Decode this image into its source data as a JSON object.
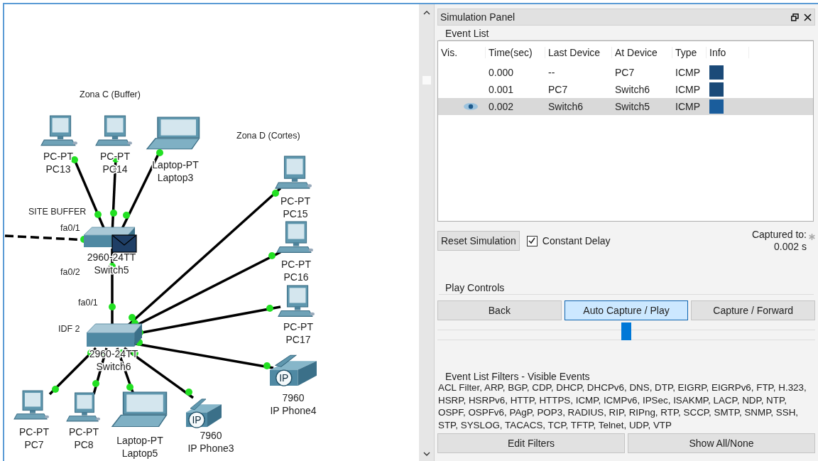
{
  "canvas": {
    "zones": [
      {
        "label": "Zona C (Buffer)"
      },
      {
        "label": "Zona D (Cortes)"
      }
    ],
    "devices": [
      {
        "kind": "pc",
        "model": "PC-PT",
        "name": "PC13"
      },
      {
        "kind": "pc",
        "model": "PC-PT",
        "name": "PC14"
      },
      {
        "kind": "laptop",
        "model": "Laptop-PT",
        "name": "Laptop3"
      },
      {
        "kind": "switch",
        "model": "2960-24TT",
        "name": "Switch5",
        "tag": "SITE BUFFER"
      },
      {
        "kind": "pc",
        "model": "PC-PT",
        "name": "PC15"
      },
      {
        "kind": "pc",
        "model": "PC-PT",
        "name": "PC16"
      },
      {
        "kind": "pc",
        "model": "PC-PT",
        "name": "PC17"
      },
      {
        "kind": "switch",
        "model": "2960-24TT",
        "name": "Switch6",
        "tag": "IDF 2"
      },
      {
        "kind": "phone",
        "model": "7960",
        "name": "IP Phone4",
        "badge": "IP"
      },
      {
        "kind": "pc",
        "model": "PC-PT",
        "name": "PC7"
      },
      {
        "kind": "pc",
        "model": "PC-PT",
        "name": "PC8"
      },
      {
        "kind": "laptop",
        "model": "Laptop-PT",
        "name": "Laptop5"
      },
      {
        "kind": "phone",
        "model": "7960",
        "name": "IP Phone3",
        "badge": "IP"
      }
    ],
    "port_labels": [
      "fa0/1",
      "fa0/2",
      "fa0/1"
    ]
  },
  "panel": {
    "title": "Simulation Panel",
    "event_list": {
      "label": "Event List",
      "columns": [
        "Vis.",
        "Time(sec)",
        "Last Device",
        "At Device",
        "Type",
        "Info"
      ],
      "rows": [
        {
          "vis": false,
          "time": "0.000",
          "last_device": "--",
          "at_device": "PC7",
          "type": "ICMP",
          "selected": false
        },
        {
          "vis": false,
          "time": "0.001",
          "last_device": "PC7",
          "at_device": "Switch6",
          "type": "ICMP",
          "selected": false
        },
        {
          "vis": true,
          "time": "0.002",
          "last_device": "Switch6",
          "at_device": "Switch5",
          "type": "ICMP",
          "selected": true
        }
      ]
    },
    "reset_button": "Reset Simulation",
    "constant_delay": {
      "label": "Constant Delay",
      "checked": true
    },
    "captured_label": "Captured to:",
    "captured_value": "0.002 s",
    "play_controls": {
      "label": "Play Controls",
      "buttons": [
        {
          "label": "Back",
          "selected": false
        },
        {
          "label": "Auto Capture / Play",
          "selected": true
        },
        {
          "label": "Capture / Forward",
          "selected": false
        }
      ],
      "slider": {
        "level": 0.5
      }
    },
    "filters": {
      "label": "Event List Filters - Visible Events",
      "text": "ACL Filter, ARP, BGP, CDP, DHCP, DHCPv6, DNS, DTP, EIGRP, EIGRPv6, FTP, H.323, HSRP, HSRPv6, HTTP, HTTPS, ICMP, ICMPv6, IPSec, ISAKMP, LACP, NDP, NTP, OSPF, OSPFv6, PAgP, POP3, RADIUS, RIP, RIPng, RTP, SCCP, SMTP, SNMP, SSH, STP, SYSLOG, TACACS, TCP, TFTP, Telnet, UDP, VTP",
      "buttons": [
        "Edit Filters",
        "Show All/None"
      ]
    }
  }
}
